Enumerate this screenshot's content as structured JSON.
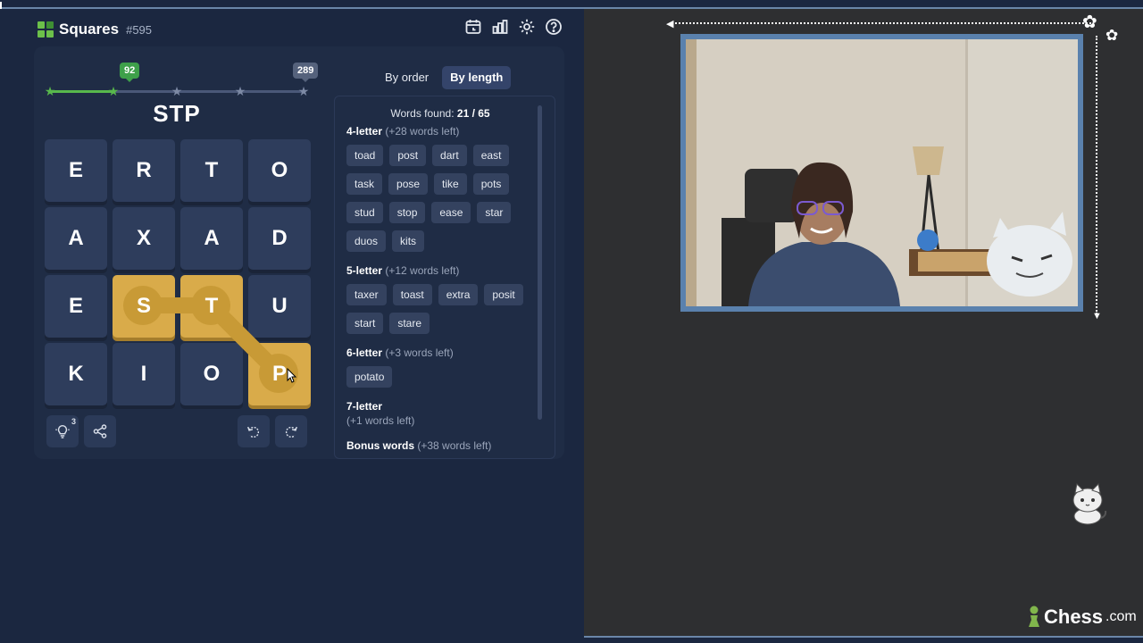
{
  "app": {
    "title": "Squares",
    "puzzle_number": "#595",
    "icons": [
      "calendar-icon",
      "stats-icon",
      "gear-icon",
      "help-icon"
    ]
  },
  "progress": {
    "badge_current": "92",
    "badge_max": "289"
  },
  "current_word": "STP",
  "grid": {
    "tiles": [
      "E",
      "R",
      "T",
      "O",
      "A",
      "X",
      "A",
      "D",
      "E",
      "S",
      "T",
      "U",
      "K",
      "I",
      "O",
      "P"
    ],
    "selected_indices": [
      9,
      10,
      15
    ]
  },
  "controls": {
    "hint_count": "3"
  },
  "tabs": {
    "by_order": "By order",
    "by_length": "By length",
    "active": "By length"
  },
  "words": {
    "found_label": "Words found:",
    "found_count": "21 / 65",
    "sections": [
      {
        "title": "4-letter",
        "left": "(+28 words left)",
        "words": [
          "toad",
          "post",
          "dart",
          "east",
          "task",
          "pose",
          "tike",
          "pots",
          "stud",
          "stop",
          "ease",
          "star",
          "duos",
          "kits"
        ]
      },
      {
        "title": "5-letter",
        "left": "(+12 words left)",
        "words": [
          "taxer",
          "toast",
          "extra",
          "posit",
          "start",
          "stare"
        ]
      },
      {
        "title": "6-letter",
        "left": "(+3 words left)",
        "words": [
          "potato"
        ]
      },
      {
        "title": "7-letter",
        "left": "(+1 words left)",
        "words": []
      },
      {
        "title": "Bonus words",
        "left": "(+38 words left)",
        "words": []
      }
    ]
  },
  "stream": {
    "brand_name": "Chess",
    "brand_suffix": ".com"
  },
  "colors": {
    "panel": "#1b2740",
    "tile": "#2e3d5c",
    "selected_tile": "#d9ab4a",
    "progress_green": "#58b84c",
    "webcam_frame": "#5a81ad"
  }
}
